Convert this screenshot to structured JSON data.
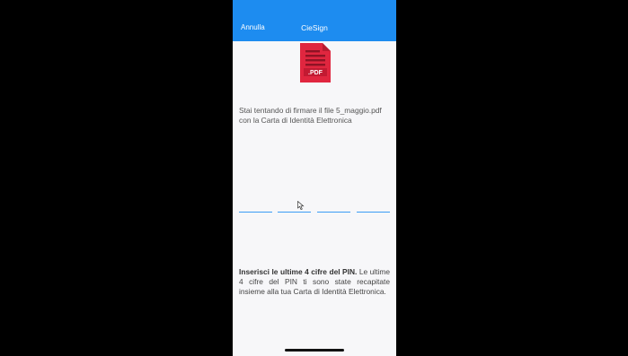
{
  "navbar": {
    "cancel_label": "Annulla",
    "title": "CieSign",
    "background": "#1d8cf0"
  },
  "document": {
    "icon": "pdf-file-icon",
    "icon_label": ".PDF",
    "icon_color": "#e0263f"
  },
  "message": {
    "line1": "Stai tentando di firmare il file 5_maggio.pdf",
    "line2": "con la Carta di Identità Elettronica"
  },
  "pin_entry": {
    "digits": [
      "",
      "",
      "",
      ""
    ],
    "underline_color": "#3b9cf5"
  },
  "instructions": {
    "bold": "Inserisci le ultime 4 cifre del PIN.",
    "text": " Le ultime 4 cifre del PIN ti sono state recapitate insieme alla tua Carta di Identità Elettronica."
  }
}
